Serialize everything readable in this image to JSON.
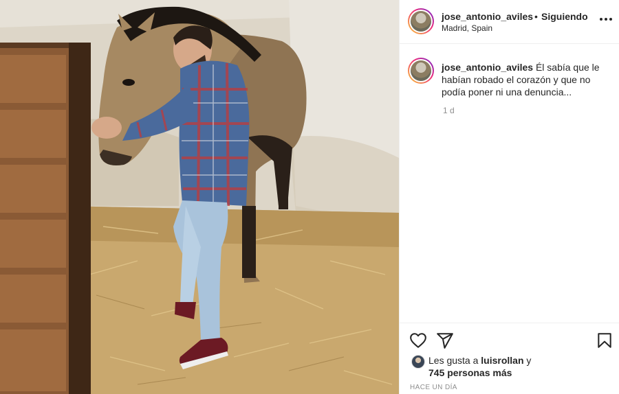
{
  "post": {
    "username": "jose_antonio_aviles",
    "separator": "•",
    "follow_status": "Siguiendo",
    "location": "Madrid, Spain",
    "caption_user": "jose_antonio_aviles",
    "caption_text": "Él sabía que le habían robado el corazón y que no podía poner ni una denuncia...",
    "caption_time": "1 d",
    "likes_prefix": "Les gusta a",
    "likes_user": "luisrollan",
    "likes_suffix": "y",
    "likes_others": "745 personas más",
    "date": "HACE UN DÍA"
  },
  "icons": {
    "more": "more-options-icon",
    "like": "heart-icon",
    "share": "paper-plane-icon",
    "save": "bookmark-icon"
  },
  "colors": {
    "text": "#262626",
    "secondary": "#8e8e8e",
    "border": "#efefef",
    "ring_start": "#f9ce34",
    "ring_mid": "#ee2a7b",
    "ring_end": "#6228d7"
  }
}
